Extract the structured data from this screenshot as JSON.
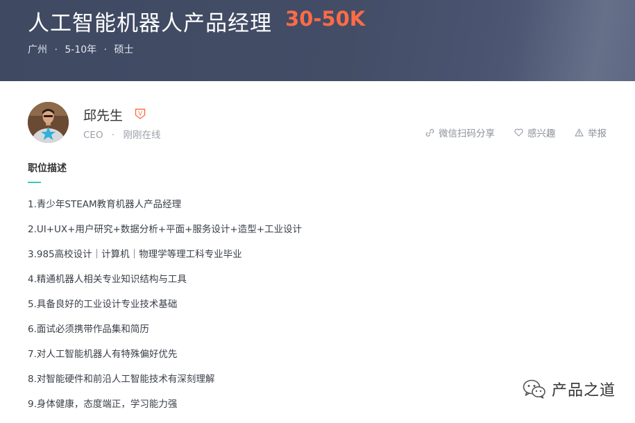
{
  "job": {
    "title": "人工智能机器人产品经理",
    "salary": "30-50K",
    "location": "广州",
    "experience": "5-10年",
    "education": "硕士",
    "separator": "·"
  },
  "recruiter": {
    "name": "邱先生",
    "role": "CEO",
    "status": "刚刚在线",
    "separator": "·",
    "verified_badge": "V"
  },
  "actions": {
    "share": "微信扫码分享",
    "interest": "感兴趣",
    "report": "举报"
  },
  "description": {
    "title": "职位描述",
    "requirements": [
      "1.青少年STEAM教育机器人产品经理",
      "2.UI+UX+用户研究+数据分析+平面+服务设计+造型+工业设计",
      "3.985高校设计｜计算机｜物理学等理工科专业毕业",
      "4.精通机器人相关专业知识结构与工具",
      "5.具备良好的工业设计专业技术基础",
      "6.面试必须携带作品集和简历",
      "7.对人工智能机器人有特殊偏好优先",
      "8.对智能硬件和前沿人工智能技术有深刻理解",
      "9.身体健康，态度端正，学习能力强"
    ]
  },
  "watermark": {
    "text": "产品之道",
    "icon": "wechat-icon"
  },
  "colors": {
    "header_bg": "#434d66",
    "salary": "#fd6b46",
    "accent_underline": "#3ec7b7",
    "verify_badge": "#fd6b46"
  }
}
